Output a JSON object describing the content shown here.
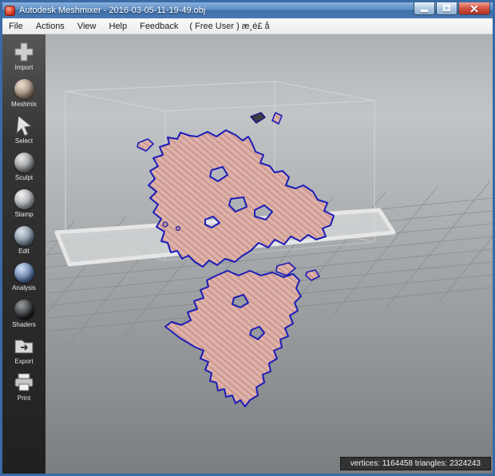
{
  "window": {
    "title": "Autodesk Meshmixer - 2016-03-05-11-19-49.obj"
  },
  "menu": {
    "items": [
      {
        "label": "File"
      },
      {
        "label": "Actions"
      },
      {
        "label": "View"
      },
      {
        "label": "Help"
      },
      {
        "label": "Feedback"
      },
      {
        "label": "( Free User ) æ¸é£ å"
      }
    ]
  },
  "sidebar": {
    "items": [
      {
        "label": "Import",
        "icon": "import-plus-icon"
      },
      {
        "label": "Meshmix",
        "icon": "meshmix-sphere-icon"
      },
      {
        "label": "Select",
        "icon": "select-cursor-icon"
      },
      {
        "label": "Sculpt",
        "icon": "sculpt-sphere-icon"
      },
      {
        "label": "Stamp",
        "icon": "stamp-sphere-icon"
      },
      {
        "label": "Edit",
        "icon": "edit-sphere-icon"
      },
      {
        "label": "Analysis",
        "icon": "analysis-sphere-icon"
      },
      {
        "label": "Shaders",
        "icon": "shaders-sphere-icon"
      },
      {
        "label": "Export",
        "icon": "export-folder-icon"
      },
      {
        "label": "Print",
        "icon": "print-printer-icon"
      }
    ]
  },
  "viewport": {
    "mesh_fill_color": "#d9aca3",
    "mesh_outline_color": "#1c1cb8",
    "plate_color": "#d2d5d7"
  },
  "statusbar": {
    "text": "vertices: 1164458 triangles: 2324243"
  }
}
